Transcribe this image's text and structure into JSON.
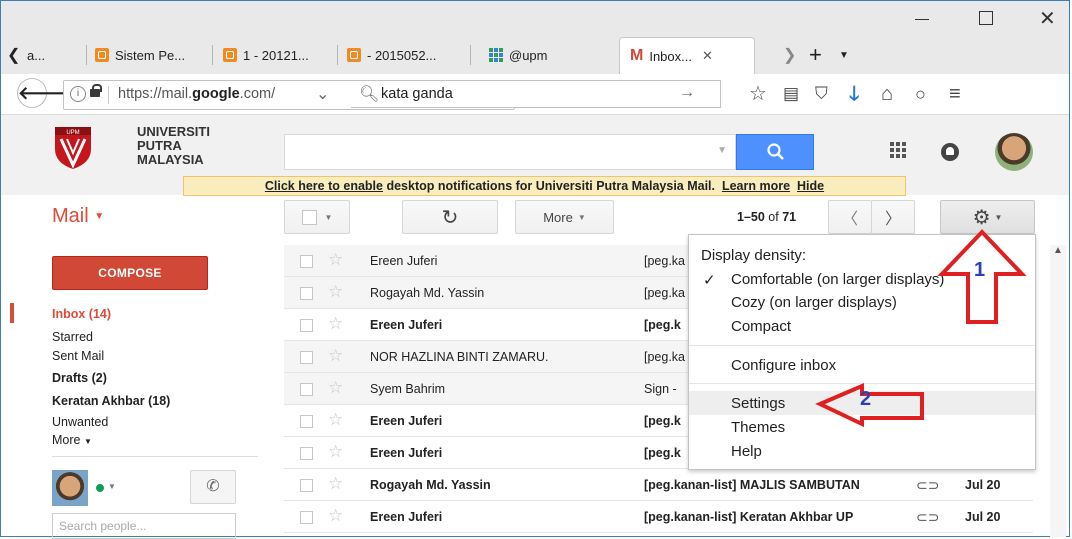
{
  "browser": {
    "tabs": [
      {
        "label": "a..."
      },
      {
        "label": "Sistem Pe..."
      },
      {
        "label": "1 - 20121..."
      },
      {
        "label": "- 2015052..."
      },
      {
        "label": "@upm"
      },
      {
        "label": "Inbox..."
      }
    ],
    "url_prefix": "https://mail.",
    "url_domain": "google",
    "url_suffix": ".com/",
    "search_text": "kata ganda"
  },
  "gmail": {
    "org_line1": "UNIVERSITI",
    "org_line2": "PUTRA",
    "org_line3": "MALAYSIA",
    "logo_text": "UPM",
    "notification": {
      "link": "Click here to enable",
      "text": " desktop notifications for Universiti Putra Malaysia Mail.",
      "learn_more": "Learn more",
      "hide": "Hide"
    },
    "mail_label": "Mail",
    "toolbar": {
      "more_label": "More",
      "page_range": "1–50",
      "page_of": "of",
      "page_total": "71"
    },
    "compose_label": "COMPOSE",
    "nav": [
      {
        "label": "Inbox (14)"
      },
      {
        "label": "Starred"
      },
      {
        "label": "Sent Mail"
      },
      {
        "label": "Drafts (2)"
      },
      {
        "label": "Keratan Akhbar (18)"
      },
      {
        "label": "Unwanted"
      },
      {
        "label": "More"
      }
    ],
    "search_people_placeholder": "Search people...",
    "emails": [
      {
        "sender": "Ereen Juferi",
        "subject": "[peg.ka",
        "date": ""
      },
      {
        "sender": "Rogayah Md. Yassin",
        "subject": "[peg.ka",
        "date": ""
      },
      {
        "sender": "Ereen Juferi",
        "subject": "[peg.k",
        "date": ""
      },
      {
        "sender": "NOR HAZLINA BINTI ZAMARU.",
        "subject": "[peg.ka",
        "date": ""
      },
      {
        "sender": "Syem Bahrim",
        "subject": "Sign -",
        "date": ""
      },
      {
        "sender": "Ereen Juferi",
        "subject": "[peg.k",
        "date": ""
      },
      {
        "sender": "Ereen Juferi",
        "subject": "[peg.k",
        "date": ""
      },
      {
        "sender": "Rogayah Md. Yassin",
        "subject": "[peg.kanan-list] MAJLIS SAMBUTAN",
        "date": "Jul 20"
      },
      {
        "sender": "Ereen Juferi",
        "subject": "[peg.kanan-list] Keratan Akhbar UP",
        "date": "Jul 20"
      }
    ],
    "menu": {
      "header": "Display density:",
      "check": "✓",
      "comfortable": "Comfortable (on larger displays)",
      "cozy": "Cozy (on larger displays)",
      "compact": "Compact",
      "configure": "Configure inbox",
      "settings": "Settings",
      "themes": "Themes",
      "help": "Help"
    }
  },
  "annotations": {
    "step1": "1",
    "step2": "2"
  },
  "colors": {
    "compose": "#d14836",
    "search_button": "#4d90fe",
    "annotation_arrow": "#e02020",
    "annotation_number": "#2a3fb8"
  }
}
